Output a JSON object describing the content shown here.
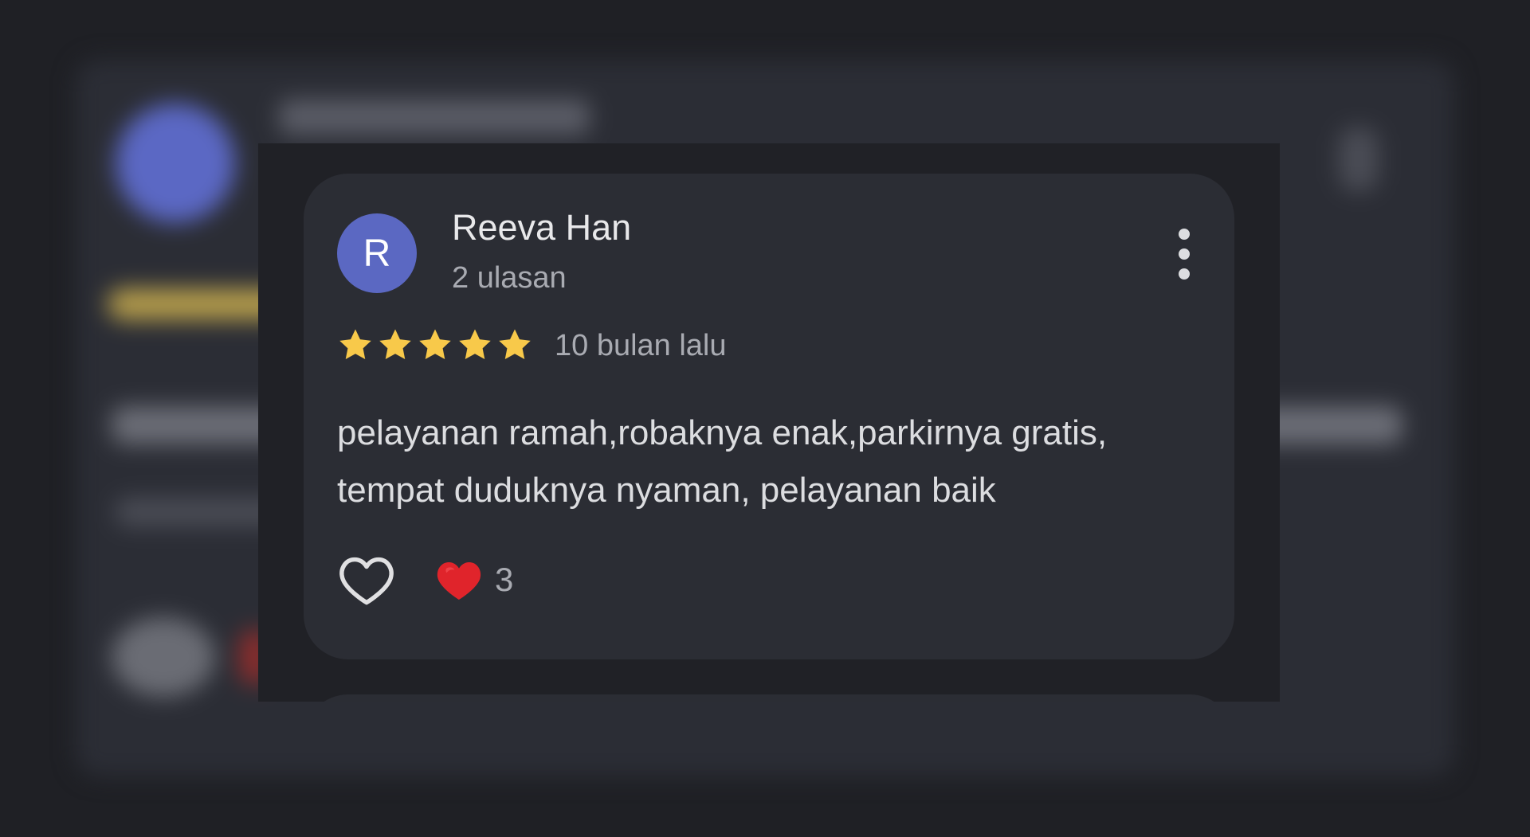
{
  "review": {
    "avatar_initial": "R",
    "reviewer_name": "Reeva Han",
    "reviewer_meta": "2 ulasan",
    "rating": 5,
    "rating_max": 5,
    "time_ago": "10 bulan lalu",
    "text": "pelayanan ramah,robaknya enak,parkirnya gratis, tempat duduknya nyaman, pelayanan baik",
    "reaction_count": "3",
    "colors": {
      "avatar": "#5b68c2",
      "star": "#f8c94a",
      "heart_reaction": "#e0242b",
      "card": "#2b2d34"
    },
    "icons": {
      "more": "more-vert-icon",
      "like": "heart-outline-icon",
      "reaction": "red-heart-icon",
      "star": "star-icon"
    }
  }
}
